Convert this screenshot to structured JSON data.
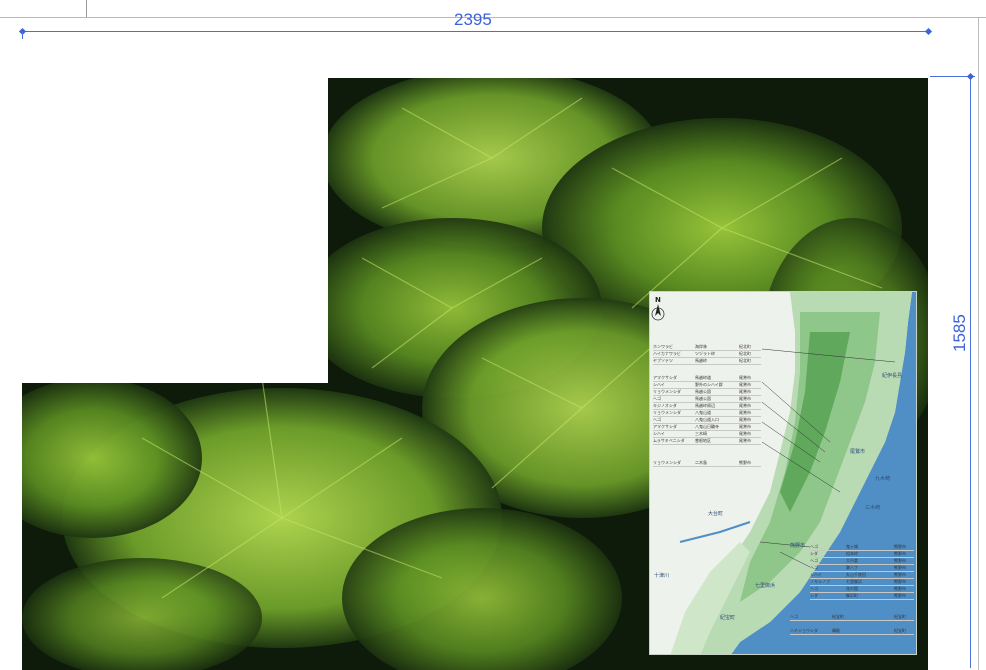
{
  "dimensions": {
    "width_label": "2395",
    "height_label": "1585"
  },
  "map": {
    "north_label": "N",
    "places": [
      "紀伊長島",
      "尾鷲市",
      "九木崎",
      "三木崎",
      "大台町",
      "熊野市",
      "紀宝町",
      "七里御浜",
      "十津川"
    ],
    "legend_top": [
      [
        "ホンワラビ",
        "海岸林",
        "紀北町"
      ],
      [
        "ハイカナワラビ",
        "ツヅラト峠",
        "紀北町"
      ],
      [
        "ヤブソテツ",
        "馬越峠",
        "紀北町"
      ]
    ],
    "legend_mid": [
      [
        "アマクサシダ",
        "馬越峠道",
        "尾鷲市"
      ],
      [
        "シハイ",
        "野外のシハイ群",
        "尾鷲市"
      ],
      [
        "リョウメンシダ",
        "馬越公園",
        "尾鷲市"
      ],
      [
        "ヘゴ",
        "馬越公園",
        "尾鷲市"
      ],
      [
        "キジノオシダ",
        "馬越峠周辺",
        "尾鷲市"
      ],
      [
        "リョウメンシダ",
        "八鬼山道",
        "尾鷲市"
      ],
      [
        "ヘゴ",
        "八鬼山道入口",
        "尾鷲市"
      ],
      [
        "アマクサシダ",
        "八鬼山日輪寺",
        "尾鷲市"
      ],
      [
        "シハイ",
        "三木崎",
        "尾鷲市"
      ],
      [
        "ムラサキベニシダ",
        "曽根地区",
        "尾鷲市"
      ]
    ],
    "legend_single": [
      [
        "リョウメンシダ",
        "二木島",
        "熊野市"
      ]
    ],
    "legend_bottom": [
      [
        "ヘゴ",
        "鬼ヶ城",
        "熊野市"
      ],
      [
        "シダ",
        "松本峠",
        "熊野市"
      ],
      [
        "ヘゴ",
        "大丹倉",
        "熊野市"
      ],
      [
        "ヘゴ",
        "瀞八丁",
        "熊野市"
      ],
      [
        "シハイ",
        "丸山千枚田",
        "熊野市"
      ],
      [
        "ノキシノブ",
        "七里御浜",
        "熊野市"
      ],
      [
        "ヘゴ",
        "花の窟",
        "熊野市"
      ],
      [
        "シダ",
        "御浜町",
        "熊野市"
      ]
    ],
    "legend_last": [
      [
        "ヘゴ",
        "紀宝町",
        "紀宝町"
      ],
      [
        "ハチジョウシダ",
        "鵜殿",
        "紀宝町"
      ]
    ]
  }
}
